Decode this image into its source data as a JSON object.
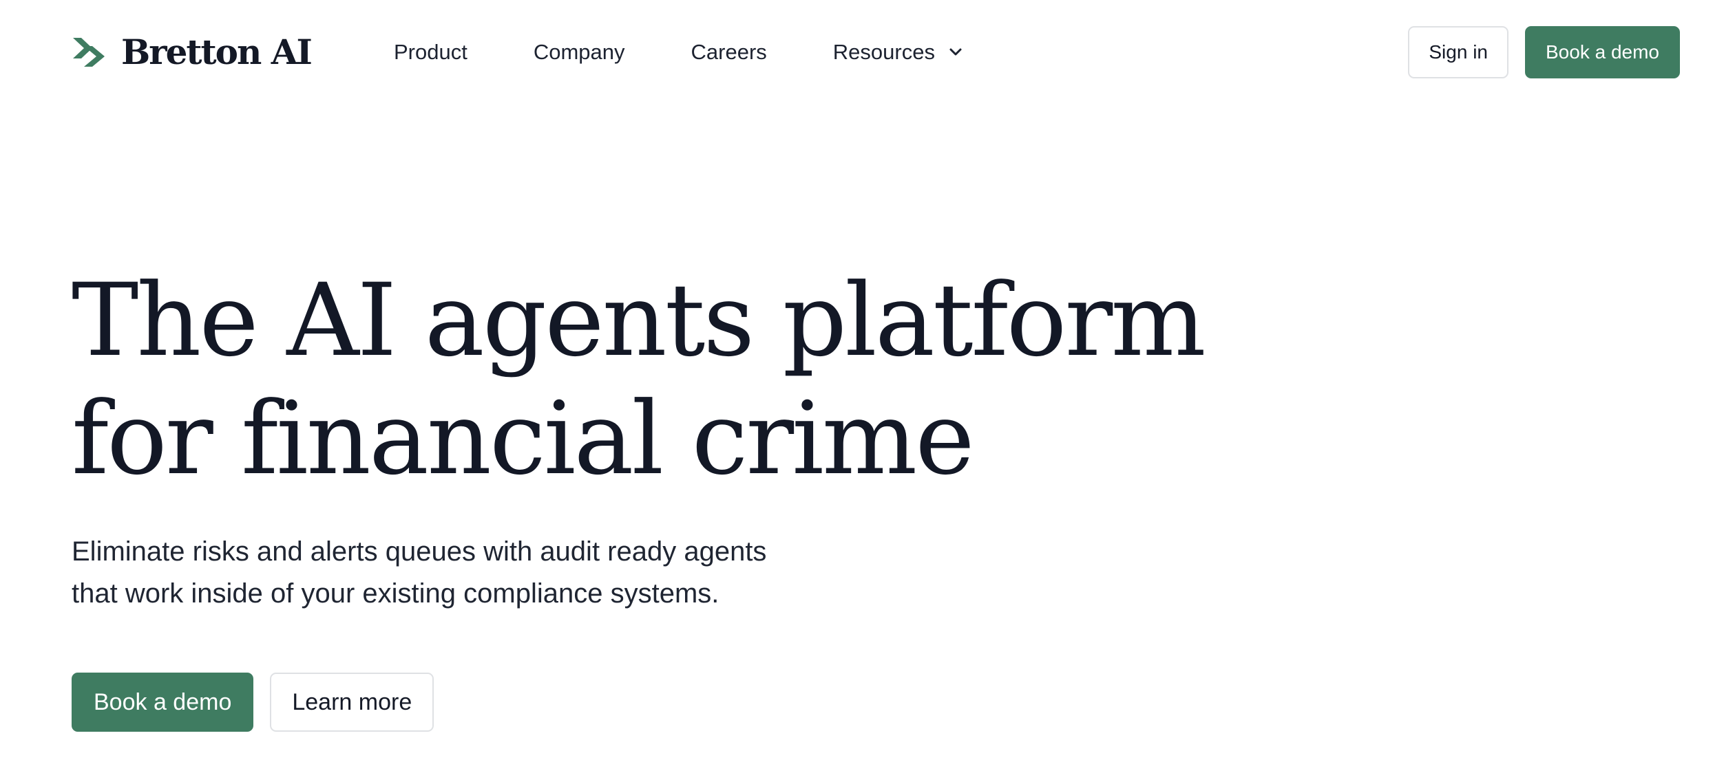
{
  "brand": {
    "name": "Bretton AI",
    "logo_icon": "double-chevron-right-icon",
    "accent_color": "#3f7c61"
  },
  "nav": {
    "items": [
      {
        "label": "Product"
      },
      {
        "label": "Company"
      },
      {
        "label": "Careers"
      },
      {
        "label": "Resources",
        "icon": "chevron-down-icon"
      }
    ]
  },
  "header_actions": {
    "sign_in_label": "Sign in",
    "book_demo_label": "Book a demo"
  },
  "hero": {
    "title_lines": [
      "The AI agents platform",
      "for financial crime"
    ],
    "subtitle_lines": [
      "Eliminate risks and alerts queues with audit ready agents",
      "that work inside of your existing compliance systems."
    ],
    "primary_cta_label": "Book a demo",
    "secondary_cta_label": "Learn more"
  }
}
